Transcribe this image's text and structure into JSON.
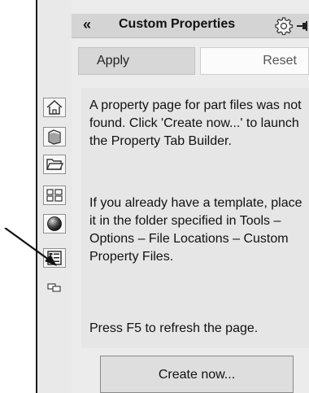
{
  "header": {
    "title": "Custom Properties",
    "collapse_icon": "double-chevron-left-icon",
    "gear_icon": "gear-icon",
    "pin_icon": "pushpin-icon"
  },
  "buttons": {
    "apply": "Apply",
    "reset": "Reset",
    "create_now": "Create now..."
  },
  "message": {
    "para1": "A property page for part files was not found. Click 'Create now...' to launch the Property Tab Builder.",
    "para2": "If you already have a template, place it in the folder specified in Tools – Options – File Locations – Custom Property Files.",
    "para3": "Press F5 to refresh the page."
  },
  "side_tabs": [
    {
      "icon": "home-icon"
    },
    {
      "icon": "book-icon"
    },
    {
      "icon": "folder-icon"
    },
    {
      "icon": "view-palette-icon"
    },
    {
      "icon": "appearance-sphere-icon"
    },
    {
      "icon": "custom-properties-icon"
    },
    {
      "icon": "callout-icon"
    }
  ],
  "colors": {
    "header_bg": "#d4d4d4",
    "panel_bg": "#e6e6e6"
  }
}
